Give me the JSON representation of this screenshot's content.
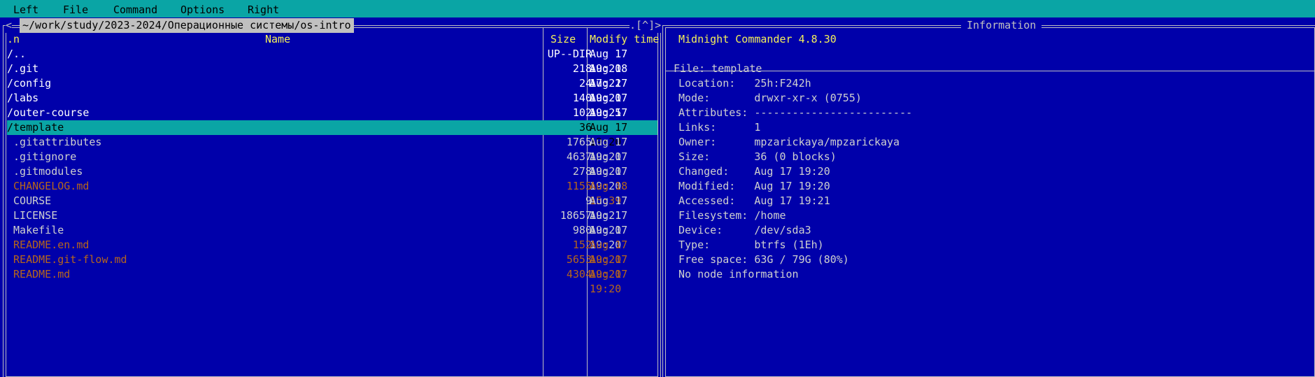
{
  "menubar": {
    "left": "Left",
    "file": "File",
    "command": "Command",
    "options": "Options",
    "right": "Right"
  },
  "left_panel": {
    "path": "~/work/study/2023-2024/Операционные системы/os-intro",
    "corner_left": "<",
    "corner_right": ".[^]>",
    "headers": {
      "sort": ".n",
      "name": "Name",
      "size": "Size",
      "time": "Modify time"
    },
    "rows": [
      {
        "name": "/..",
        "size": "UP--DIR",
        "time": "Aug 17 19:20"
      },
      {
        "name": "/.git",
        "size": "218",
        "time": "Aug 18 17:22"
      },
      {
        "name": "/config",
        "size": "24",
        "time": "Aug 17 19:20"
      },
      {
        "name": "/labs",
        "size": "140",
        "time": "Aug 17 19:25"
      },
      {
        "name": "/outer-course",
        "size": "102",
        "time": "Aug 17 21:15"
      },
      {
        "name": "/template",
        "size": "36",
        "time": "Aug 17 19:20"
      },
      {
        "name": " .gitattributes",
        "size": "1765",
        "time": "Aug 17 19:20"
      },
      {
        "name": " .gitignore",
        "size": "4637",
        "time": "Aug 17 19:20"
      },
      {
        "name": " .gitmodules",
        "size": "278",
        "time": "Aug 17 19:20"
      },
      {
        "name": " CHANGELOG.md",
        "size": "1155",
        "time": "Aug 18 15:39"
      },
      {
        "name": " COURSE",
        "size": "9",
        "time": "Aug 17 19:21"
      },
      {
        "name": " LICENSE",
        "size": "18657",
        "time": "Aug 17 19:20"
      },
      {
        "name": " Makefile",
        "size": "980",
        "time": "Aug 17 19:20"
      },
      {
        "name": " README.en.md",
        "size": "152",
        "time": "Aug 17 19:20"
      },
      {
        "name": " README.git-flow.md",
        "size": "5653",
        "time": "Aug 17 19:20"
      },
      {
        "name": " README.md",
        "size": "4304",
        "time": "Aug 17 19:20"
      }
    ]
  },
  "right_panel": {
    "title": "Information",
    "app_name": "Midnight Commander 4.8.30",
    "file_line": "File: template",
    "info": [
      "Location:   25h:F242h",
      "Mode:       drwxr-xr-x (0755)",
      "Attributes: -------------------------",
      "Links:      1",
      "Owner:      mpzarickaya/mpzarickaya",
      "Size:       36 (0 blocks)",
      "Changed:    Aug 17 19:20",
      "Modified:   Aug 17 19:20",
      "Accessed:   Aug 17 19:21",
      "Filesystem: /home",
      "Device:     /dev/sda3",
      "Type:       btrfs (1Eh)",
      "Free space: 63G / 79G (80%)",
      "No node information"
    ]
  },
  "colors": {
    "background": "#0000aa",
    "highlight": "#0aa5a5",
    "header": "#f5f05a",
    "markdown": "#b5651d"
  }
}
